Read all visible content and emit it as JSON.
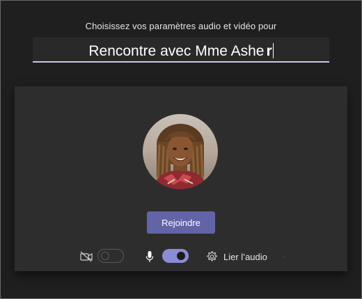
{
  "dialog": {
    "heading": "Choisissez vos paramètres audio et vidéo pour"
  },
  "meeting": {
    "title": "Rencontre avec Mme Ashe",
    "typed_char": "r"
  },
  "preview": {
    "join_label": "Rejoindre",
    "camera": {
      "icon": "video-off-icon",
      "enabled": false
    },
    "microphone": {
      "icon": "microphone-icon",
      "enabled": true
    },
    "audio_settings": {
      "icon": "gear-icon",
      "label": "Lier l’audio"
    }
  },
  "colors": {
    "window_bg": "#1f1f1f",
    "panel_bg": "#2d2d2d",
    "accent": "#6264a7",
    "toggle_on": "#8b8cd6",
    "text": "#e6e6e6"
  }
}
